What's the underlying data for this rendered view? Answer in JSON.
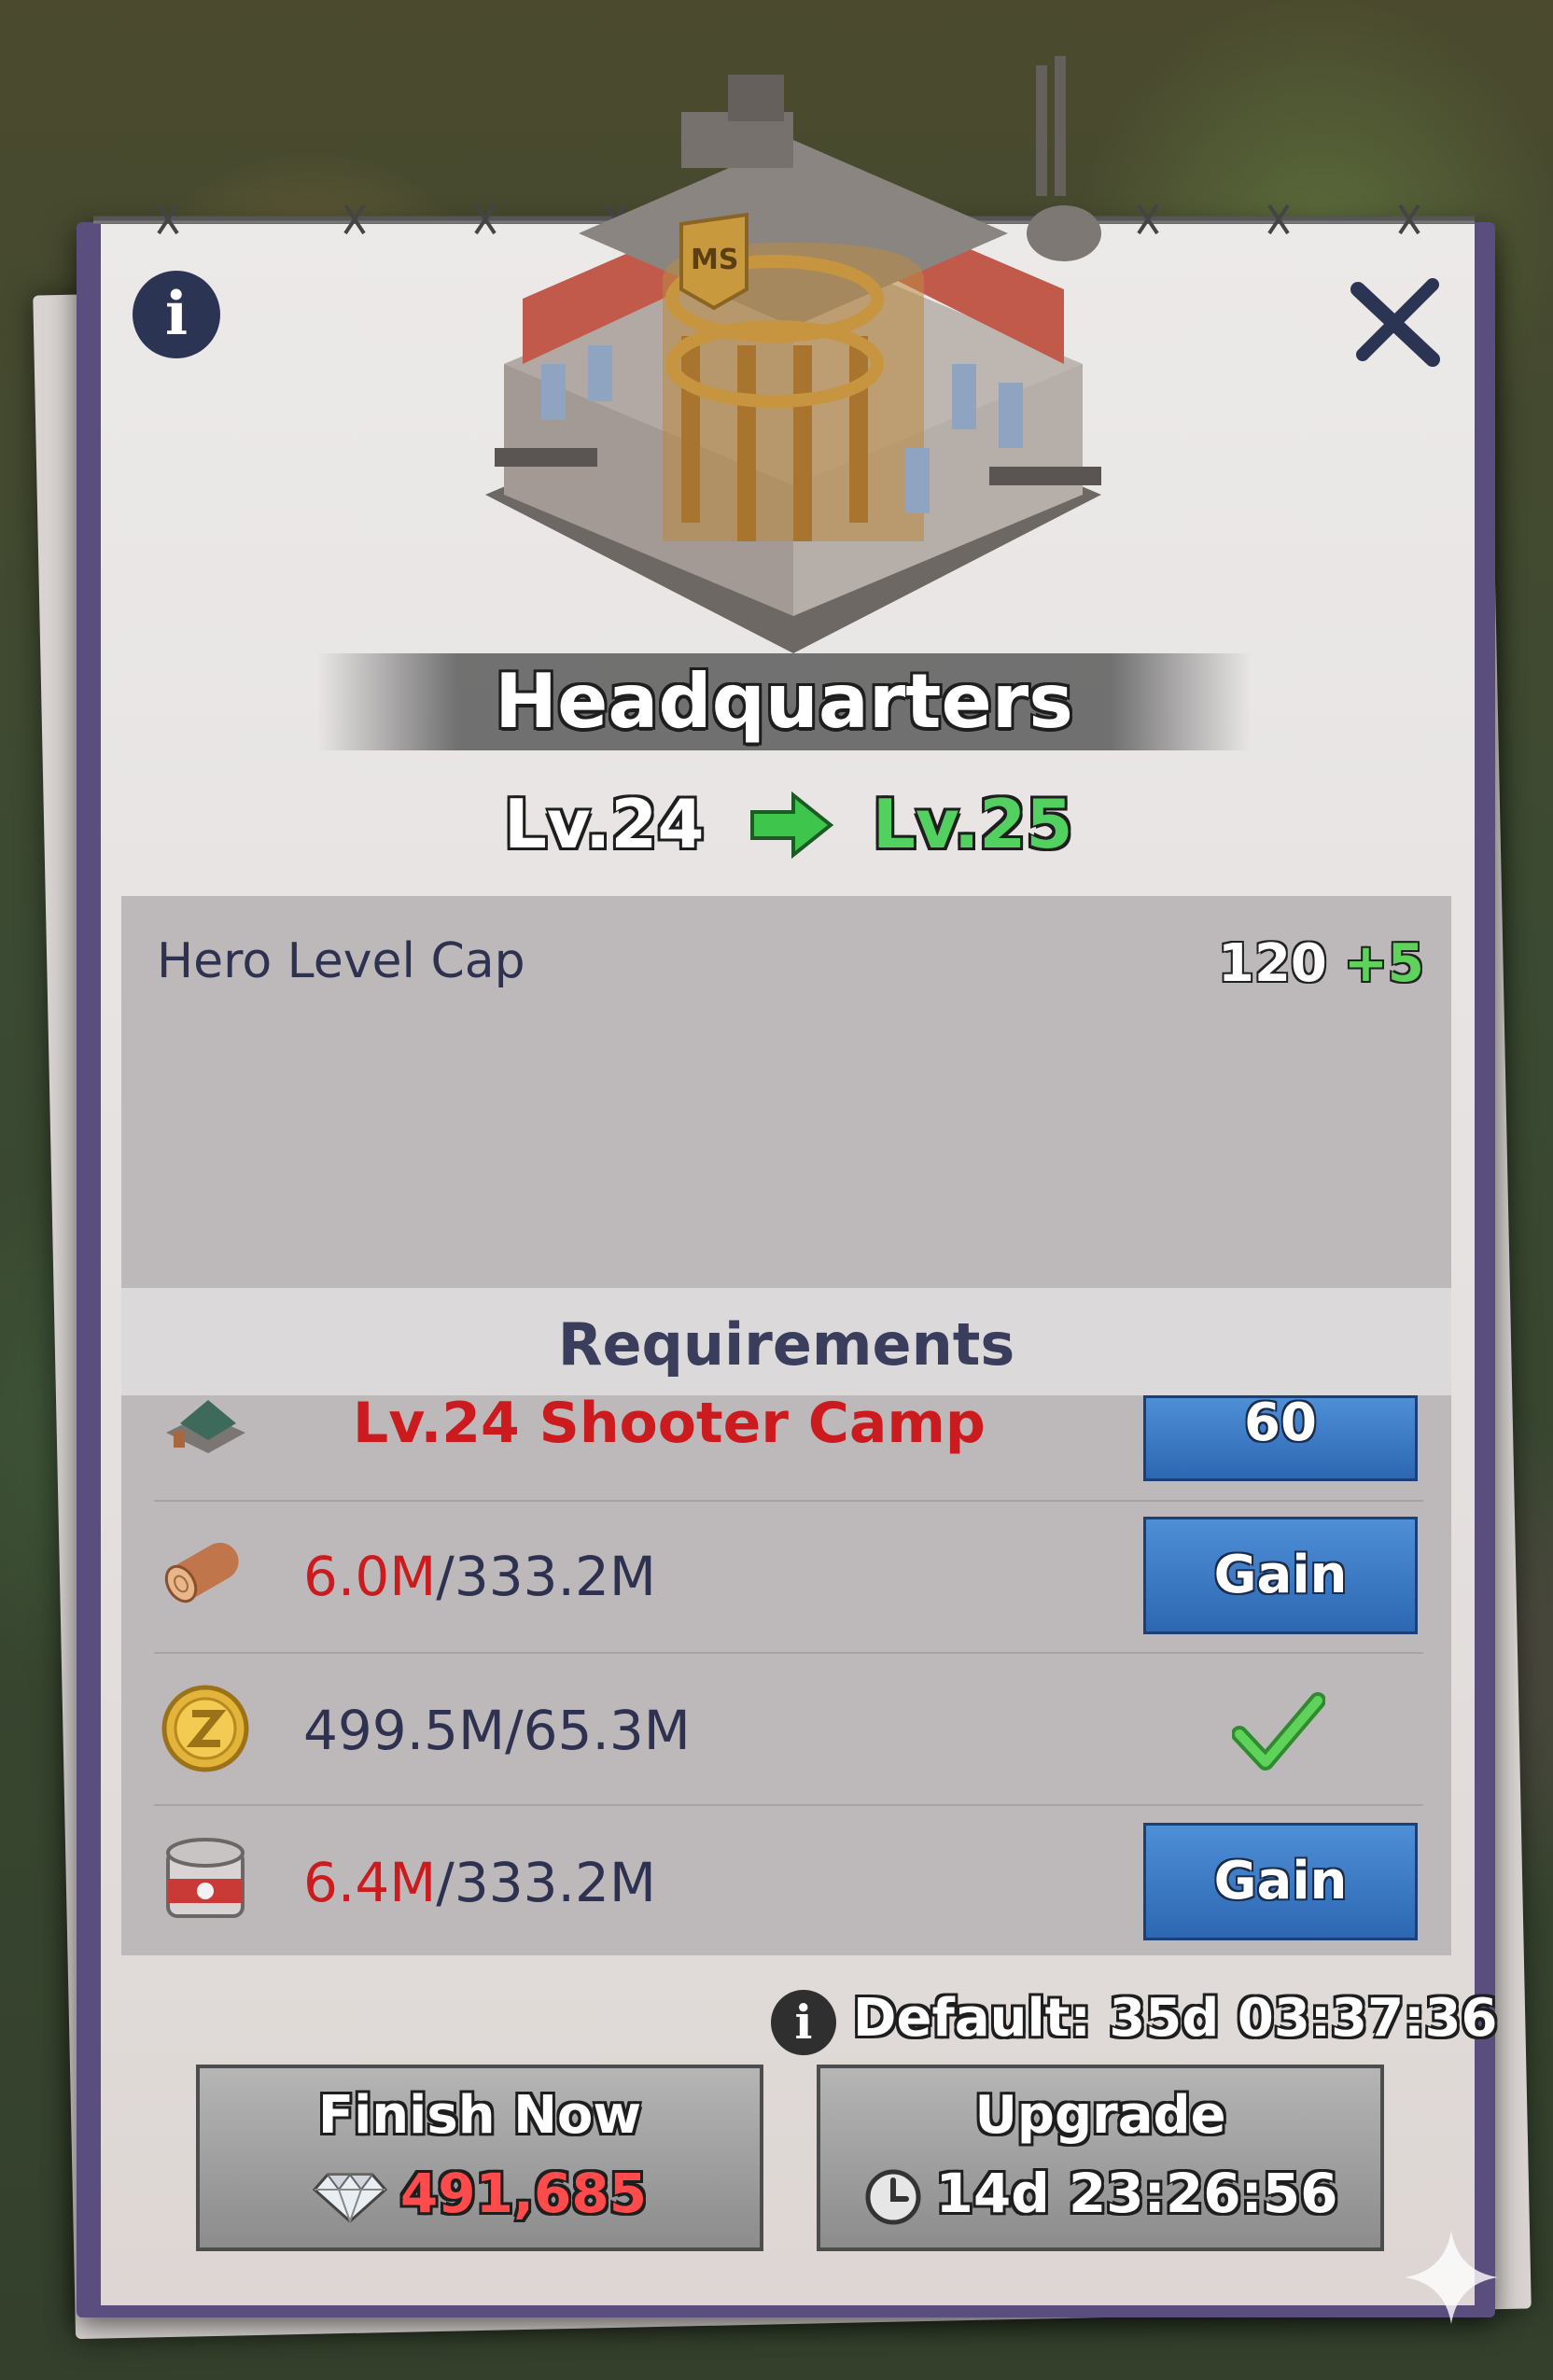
{
  "building": {
    "name": "Headquarters",
    "badge": "MS",
    "current_level": "Lv.24",
    "next_level": "Lv.25"
  },
  "stats": [
    {
      "label": "Hero Level Cap",
      "value": "120",
      "bonus": "+5"
    }
  ],
  "requirements": {
    "header": "Requirements",
    "items": [
      {
        "icon": "camp-icon",
        "text": "Lv.24 Shooter Camp",
        "action": "60"
      },
      {
        "icon": "wood-icon",
        "have": "6.0M",
        "need": "/333.2M",
        "action": "Gain",
        "met": false
      },
      {
        "icon": "coin-icon",
        "have": "499.5M",
        "need": "/65.3M",
        "met": true
      },
      {
        "icon": "food-can-icon",
        "have": "6.4M",
        "need": "/333.2M",
        "action": "Gain",
        "met": false
      }
    ]
  },
  "default_time": "Default: 35d 03:37:36",
  "buttons": {
    "finish_label": "Finish Now",
    "finish_cost": "491,685",
    "upgrade_label": "Upgrade",
    "upgrade_time": "14d 23:26:56"
  },
  "colors": {
    "accent_green": "#52d060",
    "shortfall_red": "#cc1b1e",
    "gain_blue": "#3a78c4",
    "panel_purple": "#5a4e7e"
  }
}
